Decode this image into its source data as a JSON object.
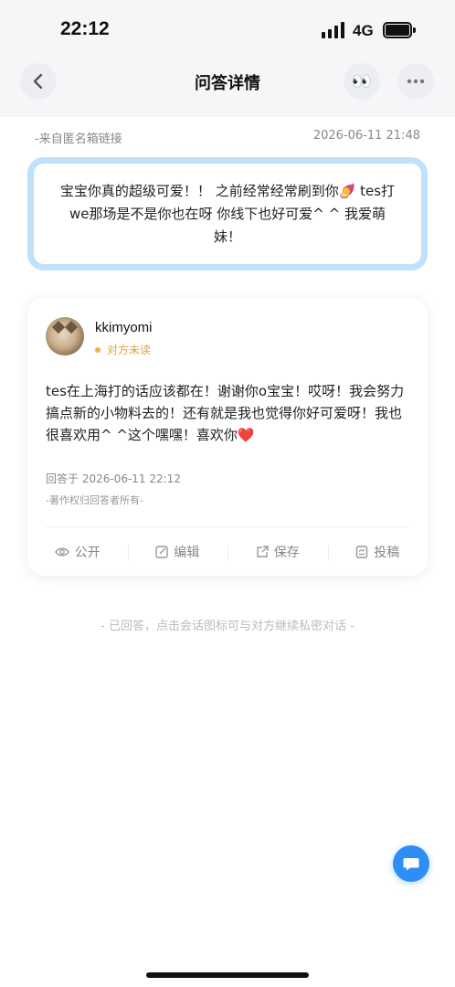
{
  "status_bar": {
    "time": "22:12",
    "network": "4G",
    "icons": [
      "signal-icon",
      "battery-icon"
    ]
  },
  "nav": {
    "title": "问答详情",
    "back_icon": "chevron-left-icon",
    "eyes_emoji": "👀",
    "more_icon": "more-icon"
  },
  "question": {
    "source": "-来自匿名箱链接",
    "time": "2026-06-11 21:48",
    "text": "宝宝你真的超级可爱！！ 之前经常经常刷到你🍠 tes打we那场是不是你也在呀 你线下也好可爱^ ^ 我爱萌妹！"
  },
  "answer": {
    "name": "kkimyomi",
    "read_status": "对方未读",
    "text": "tes在上海打的话应该都在！谢谢你o宝宝！哎呀！我会努力搞点新的小物料去的！还有就是我也觉得你好可爱呀！我也很喜欢用^ ^这个嘿嘿！喜欢你❤️",
    "answered_at": "回答于 2026-06-11 22:12",
    "copyright": "-著作权归回答者所有-"
  },
  "actions": [
    {
      "label": "公开",
      "icon": "eye-icon"
    },
    {
      "label": "编辑",
      "icon": "edit-icon"
    },
    {
      "label": "保存",
      "icon": "share-export-icon"
    },
    {
      "label": "投稿",
      "icon": "submit-icon"
    }
  ],
  "footer_hint": "- 已回答，点击会话图标可与对方继续私密对话 -",
  "colors": {
    "accent": "#2f8ef6",
    "card_border": "#bfe1fb",
    "unread": "#f2b441",
    "header_bg": "#f5f6f8"
  }
}
